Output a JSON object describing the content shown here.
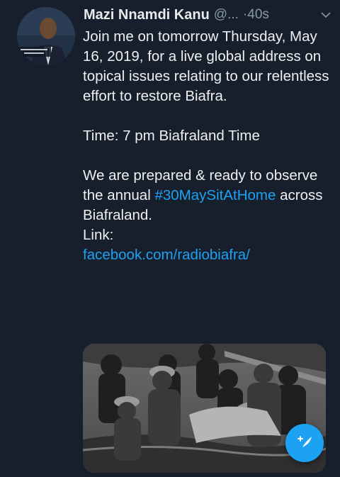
{
  "tweet": {
    "author_name": "Mazi Nnamdi Kanu",
    "handle": "@...",
    "time": "·40s",
    "paragraphs": {
      "p1": "Join me on tomorrow Thursday, May 16, 2019, for a live global address on topical issues relating to our relentless effort to restore Biafra.",
      "p2": "Time: 7 pm Biafraland Time",
      "p3_line1": "We are prepared & ready to observe the annual",
      "hashtag": "#30MaySitAtHome",
      "p3_after_hashtag": " across Biafraland.",
      "link_label": "Link:",
      "link_url": "facebook.com/radiobiafra/"
    }
  },
  "icons": {
    "caret": "chevron-down-icon",
    "compose": "compose-feather-icon"
  },
  "colors": {
    "background": "#161f2b",
    "text": "#eef0f2",
    "secondary_text": "#8899a6",
    "accent": "#1da1f2"
  }
}
